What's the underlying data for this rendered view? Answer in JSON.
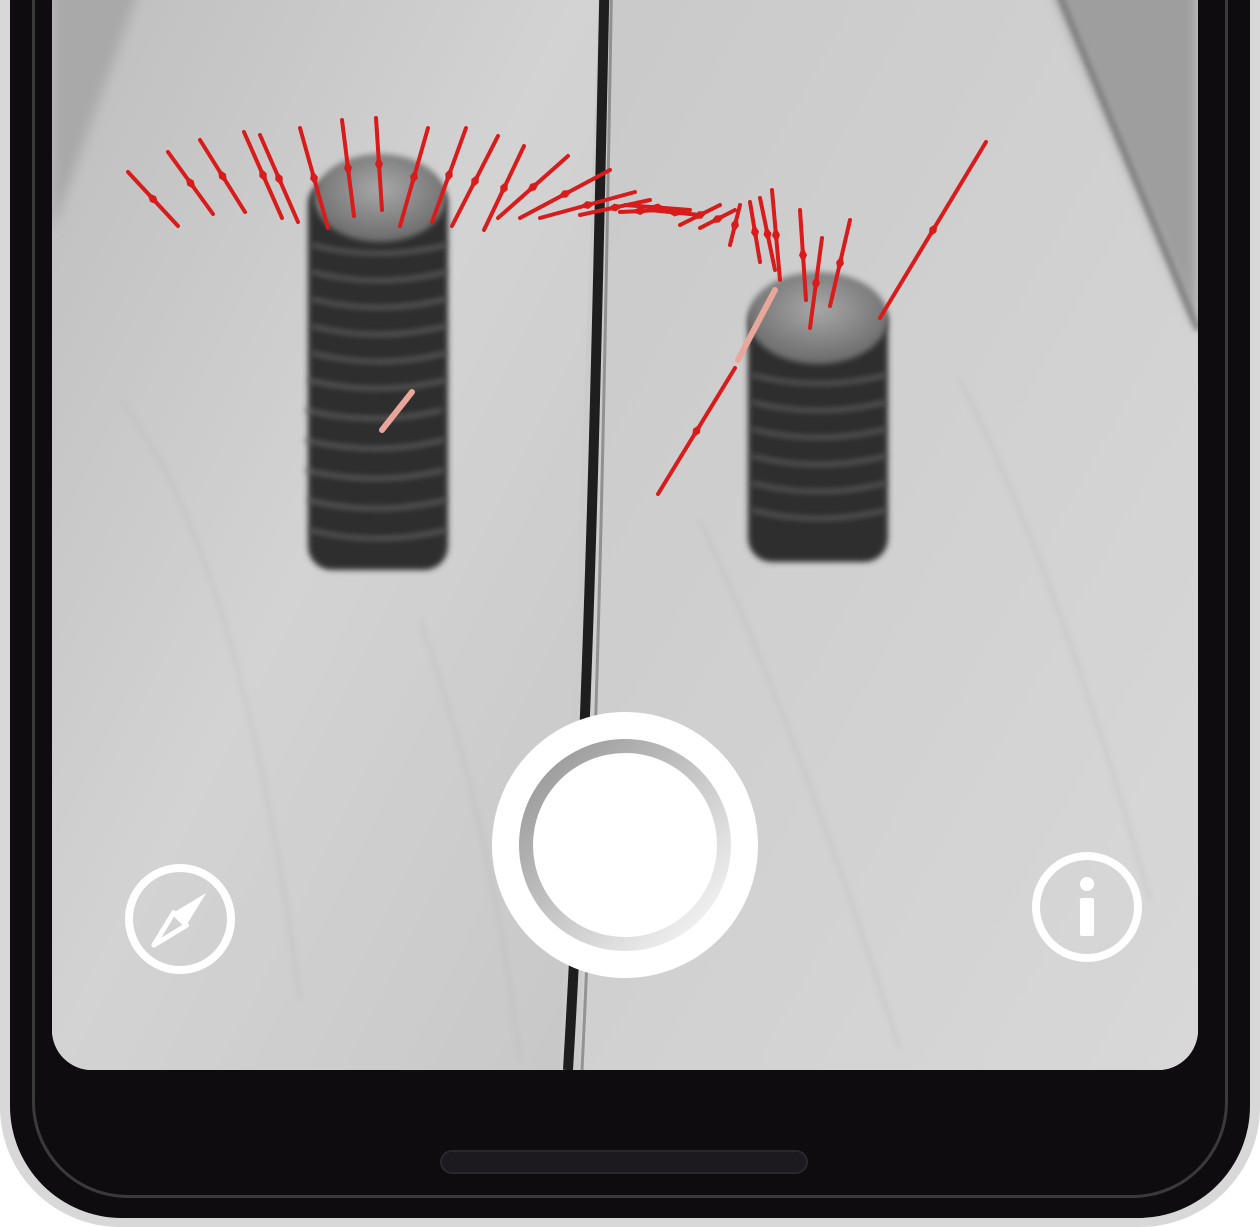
{
  "controls": {
    "compass": {
      "icon": "compass-icon"
    },
    "shutter": {
      "icon": "shutter-icon"
    },
    "info": {
      "icon": "info-icon"
    }
  },
  "colors": {
    "arrow_red": "#d81b1b",
    "arrow_pale": "#e8a79a",
    "button_white": "#ffffff",
    "phone_black": "#0f0c10"
  }
}
